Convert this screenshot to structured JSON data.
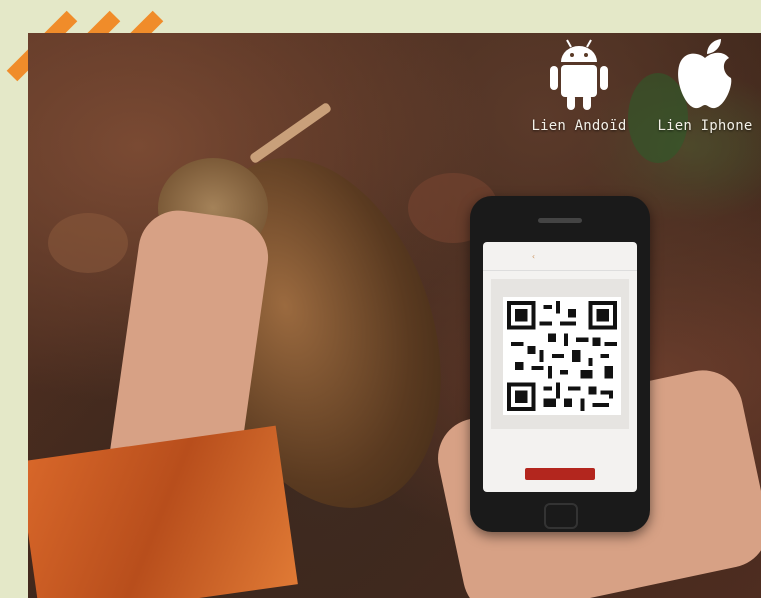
{
  "links": {
    "android_label": "Lien Andoïd",
    "iphone_label": "Lien Iphone"
  },
  "icons": {
    "android": "android-icon",
    "apple": "apple-icon"
  },
  "colors": {
    "background": "#e4e8c8",
    "stripes": "#f08c2a",
    "label_text": "#f4f1e8"
  }
}
